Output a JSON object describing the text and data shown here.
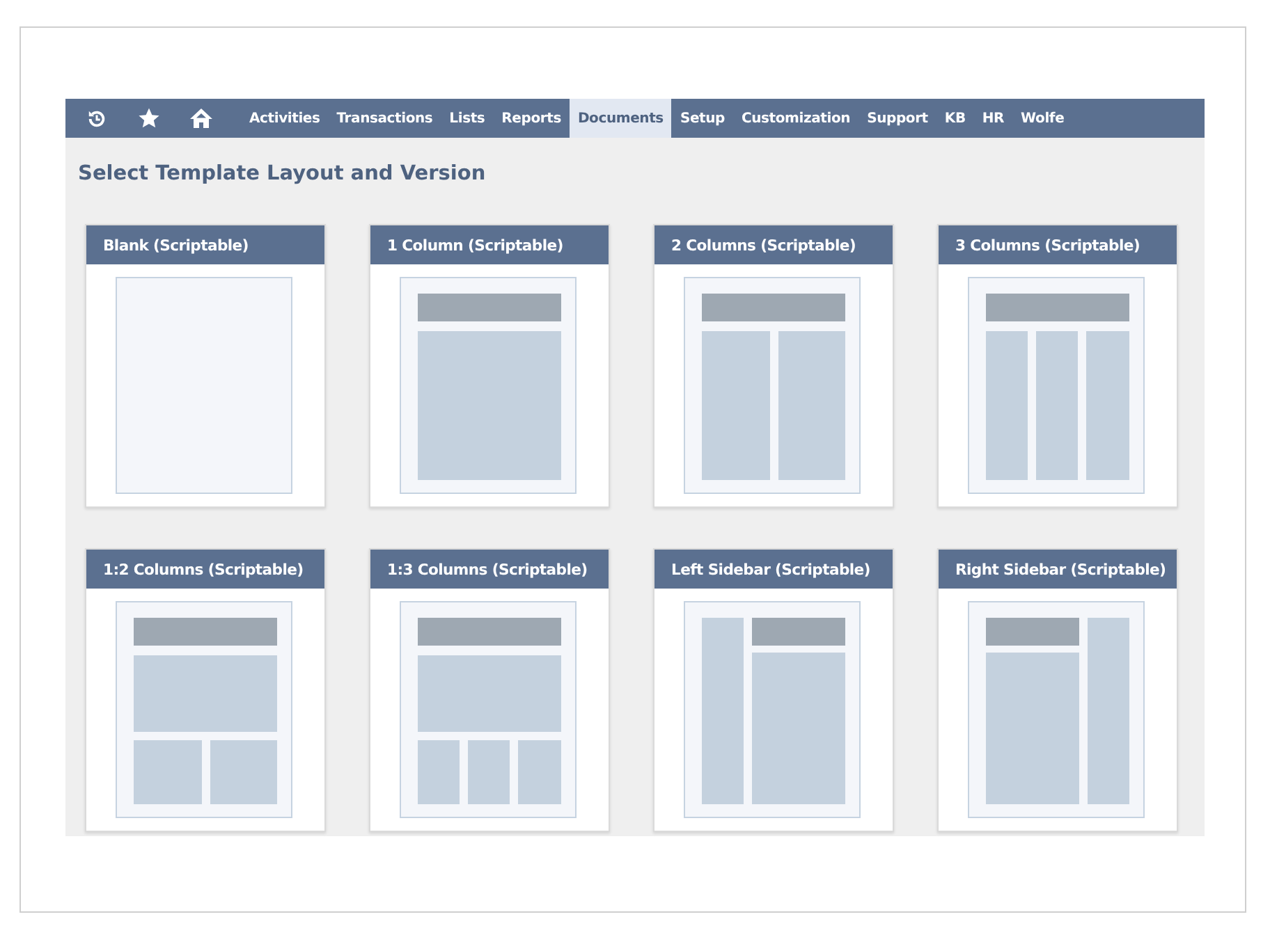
{
  "nav": {
    "icons": [
      {
        "kind": "history"
      },
      {
        "kind": "star"
      },
      {
        "kind": "home"
      }
    ],
    "items": [
      {
        "label": "Activities",
        "selected": false
      },
      {
        "label": "Transactions",
        "selected": false
      },
      {
        "label": "Lists",
        "selected": false
      },
      {
        "label": "Reports",
        "selected": false
      },
      {
        "label": "Documents",
        "selected": true
      },
      {
        "label": "Setup",
        "selected": false
      },
      {
        "label": "Customization",
        "selected": false
      },
      {
        "label": "Support",
        "selected": false
      },
      {
        "label": "KB",
        "selected": false
      },
      {
        "label": "HR",
        "selected": false
      },
      {
        "label": "Wolfe",
        "selected": false
      }
    ]
  },
  "heading": "Select Template Layout and Version",
  "templates": [
    {
      "title": "Blank (Scriptable)",
      "kind": "blank"
    },
    {
      "title": "1 Column (Scriptable)",
      "kind": "one-column"
    },
    {
      "title": "2 Columns (Scriptable)",
      "kind": "two-columns"
    },
    {
      "title": "3 Columns (Scriptable)",
      "kind": "three-columns"
    },
    {
      "title": "1:2 Columns (Scriptable)",
      "kind": "one-two"
    },
    {
      "title": "1:3 Columns (Scriptable)",
      "kind": "one-three"
    },
    {
      "title": "Left Sidebar (Scriptable)",
      "kind": "left-sidebar"
    },
    {
      "title": "Right Sidebar (Scriptable)",
      "kind": "right-sidebar"
    }
  ]
}
